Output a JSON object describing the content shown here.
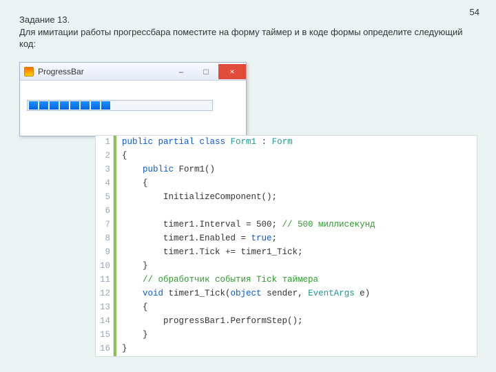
{
  "pageNumber": "54",
  "task": {
    "line1": "Задание 13.",
    "line2": "Для имитации работы прогрессбара поместите на форму таймер и в коде формы определите следующий код:"
  },
  "window": {
    "title": "ProgressBar",
    "minGlyph": "–",
    "maxGlyph": "□",
    "closeGlyph": "×",
    "progressSegments": 8
  },
  "code": {
    "lines": [
      [
        {
          "t": "k",
          "s": "public "
        },
        {
          "t": "k",
          "s": "partial "
        },
        {
          "t": "k",
          "s": "class "
        },
        {
          "t": "t",
          "s": "Form1"
        },
        {
          "t": "n",
          "s": " : "
        },
        {
          "t": "t",
          "s": "Form"
        }
      ],
      [
        {
          "t": "n",
          "s": "{"
        }
      ],
      [
        {
          "t": "n",
          "s": "    "
        },
        {
          "t": "k",
          "s": "public "
        },
        {
          "t": "n",
          "s": "Form1()"
        }
      ],
      [
        {
          "t": "n",
          "s": "    {"
        }
      ],
      [
        {
          "t": "n",
          "s": "        InitializeComponent();"
        }
      ],
      [],
      [
        {
          "t": "n",
          "s": "        timer1.Interval = 500; "
        },
        {
          "t": "c",
          "s": "// 500 миллисекунд"
        }
      ],
      [
        {
          "t": "n",
          "s": "        timer1.Enabled = "
        },
        {
          "t": "k",
          "s": "true"
        },
        {
          "t": "n",
          "s": ";"
        }
      ],
      [
        {
          "t": "n",
          "s": "        timer1.Tick += timer1_Tick;"
        }
      ],
      [
        {
          "t": "n",
          "s": "    }"
        }
      ],
      [
        {
          "t": "n",
          "s": "    "
        },
        {
          "t": "c",
          "s": "// обработчик события Tick таймера"
        }
      ],
      [
        {
          "t": "n",
          "s": "    "
        },
        {
          "t": "k",
          "s": "void "
        },
        {
          "t": "n",
          "s": "timer1_Tick("
        },
        {
          "t": "k",
          "s": "object "
        },
        {
          "t": "n",
          "s": "sender, "
        },
        {
          "t": "t",
          "s": "EventArgs"
        },
        {
          "t": "n",
          "s": " e)"
        }
      ],
      [
        {
          "t": "n",
          "s": "    {"
        }
      ],
      [
        {
          "t": "n",
          "s": "        progressBar1.PerformStep();"
        }
      ],
      [
        {
          "t": "n",
          "s": "    }"
        }
      ],
      [
        {
          "t": "n",
          "s": "}"
        }
      ]
    ]
  }
}
